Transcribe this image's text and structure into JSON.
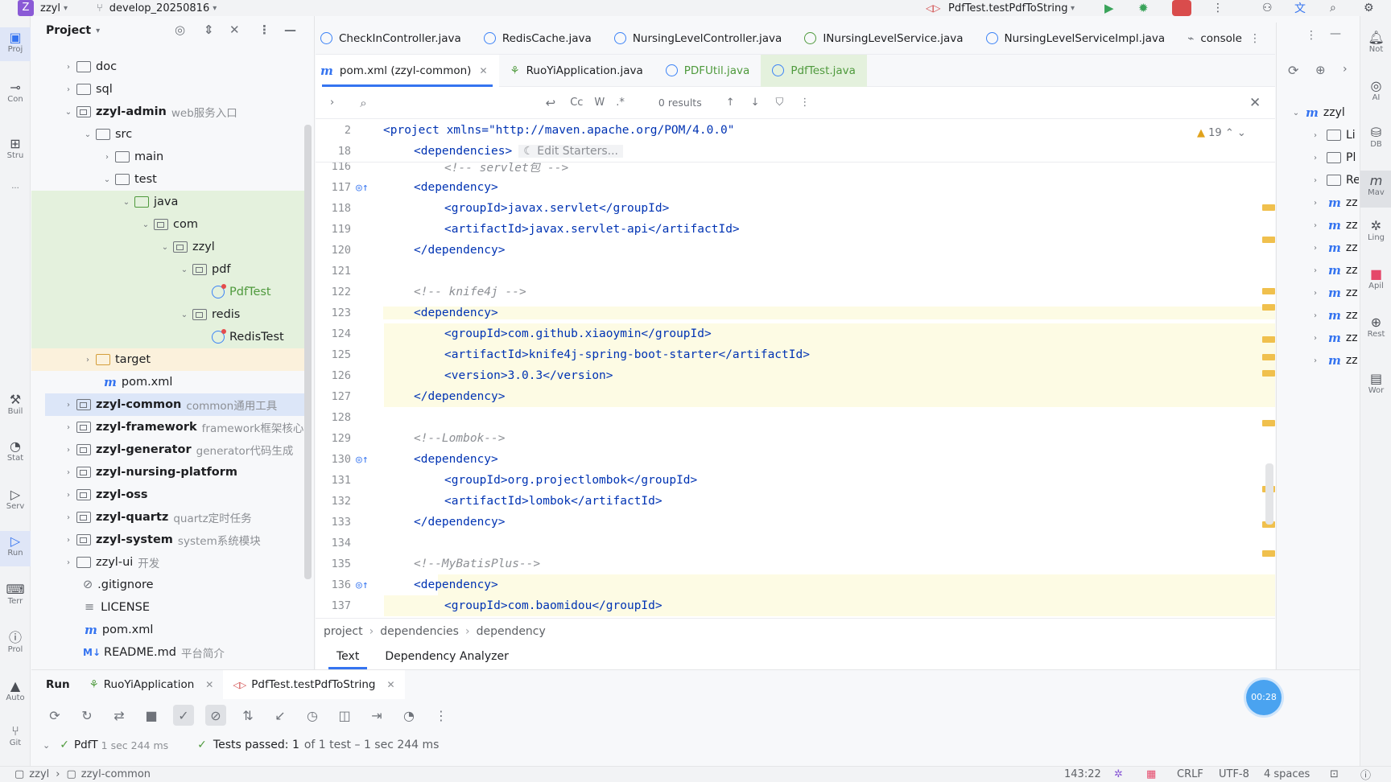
{
  "topbar": {
    "project_badge": "Z",
    "project_name": "zzyl",
    "branch": "develop_20250816",
    "run_config": "PdfTest.testPdfToString"
  },
  "left_strip": [
    "Proj",
    "Con",
    "Stru",
    "...",
    "Buil",
    "Stat",
    "Serv",
    "Run",
    "Terr",
    "Prol",
    "Auto",
    "Git"
  ],
  "project_panel": {
    "title": "Project",
    "tree": [
      {
        "label": "doc",
        "extra": ""
      },
      {
        "label": "sql",
        "extra": ""
      },
      {
        "label": "zzyl-admin",
        "extra": "web服务入口"
      },
      {
        "label": "src",
        "extra": ""
      },
      {
        "label": "main",
        "extra": ""
      },
      {
        "label": "test",
        "extra": ""
      },
      {
        "label": "java",
        "extra": ""
      },
      {
        "label": "com",
        "extra": ""
      },
      {
        "label": "zzyl",
        "extra": ""
      },
      {
        "label": "pdf",
        "extra": ""
      },
      {
        "label": "PdfTest",
        "extra": ""
      },
      {
        "label": "redis",
        "extra": ""
      },
      {
        "label": "RedisTest",
        "extra": ""
      },
      {
        "label": "target",
        "extra": ""
      },
      {
        "label": "pom.xml",
        "extra": ""
      },
      {
        "label": "zzyl-common",
        "extra": "common通用工具"
      },
      {
        "label": "zzyl-framework",
        "extra": "framework框架核心"
      },
      {
        "label": "zzyl-generator",
        "extra": "generator代码生成"
      },
      {
        "label": "zzyl-nursing-platform",
        "extra": ""
      },
      {
        "label": "zzyl-oss",
        "extra": ""
      },
      {
        "label": "zzyl-quartz",
        "extra": "quartz定时任务"
      },
      {
        "label": "zzyl-system",
        "extra": "system系统模块"
      },
      {
        "label": "zzyl-ui",
        "extra": "开发"
      },
      {
        "label": ".gitignore",
        "extra": ""
      },
      {
        "label": "LICENSE",
        "extra": ""
      },
      {
        "label": "pom.xml",
        "extra": ""
      },
      {
        "label": "README.md",
        "extra": "平台简介"
      }
    ]
  },
  "tabs_row1": [
    "CheckInController.java",
    "RedisCache.java",
    "NursingLevelController.java",
    "INursingLevelService.java",
    "NursingLevelServiceImpl.java",
    "console"
  ],
  "tabs_row2": [
    "pom.xml (zzyl-common)",
    "RuoYiApplication.java",
    "PDFUtil.java",
    "PdfTest.java"
  ],
  "search": {
    "results": "0 results",
    "case": "Cc",
    "word": "W",
    "regex": ".*"
  },
  "sticky": {
    "l1_num": "2",
    "l1_text": "<project xmlns=\"http://maven.apache.org/POM/4.0.0\"",
    "l2_num": "18",
    "l2_text": "<dependencies>",
    "l2_hint": "Edit Starters...",
    "warnings": "19"
  },
  "code_lines": [
    {
      "n": "116",
      "t": "<!-- servlet包 -->"
    },
    {
      "n": "117",
      "t": "<dependency>"
    },
    {
      "n": "118",
      "t": "<groupId>javax.servlet</groupId>"
    },
    {
      "n": "119",
      "t": "<artifactId>javax.servlet-api</artifactId>"
    },
    {
      "n": "120",
      "t": "</dependency>"
    },
    {
      "n": "121",
      "t": ""
    },
    {
      "n": "122",
      "t": "<!-- knife4j -->"
    },
    {
      "n": "123",
      "t": "<dependency>"
    },
    {
      "n": "124",
      "t": "<groupId>com.github.xiaoymin</groupId>"
    },
    {
      "n": "125",
      "t": "<artifactId>knife4j-spring-boot-starter</artifactId>"
    },
    {
      "n": "126",
      "t": "<version>3.0.3</version>"
    },
    {
      "n": "127",
      "t": "</dependency>"
    },
    {
      "n": "128",
      "t": ""
    },
    {
      "n": "129",
      "t": "<!--Lombok-->"
    },
    {
      "n": "130",
      "t": "<dependency>"
    },
    {
      "n": "131",
      "t": "<groupId>org.projectlombok</groupId>"
    },
    {
      "n": "132",
      "t": "<artifactId>lombok</artifactId>"
    },
    {
      "n": "133",
      "t": "</dependency>"
    },
    {
      "n": "134",
      "t": ""
    },
    {
      "n": "135",
      "t": "<!--MyBatisPlus-->"
    },
    {
      "n": "136",
      "t": "<dependency>"
    },
    {
      "n": "137",
      "t": "<groupId>com.baomidou</groupId>"
    }
  ],
  "breadcrumb": [
    "project",
    "dependencies",
    "dependency"
  ],
  "view_tabs": [
    "Text",
    "Dependency Analyzer"
  ],
  "maven": {
    "root": "zzyl",
    "items": [
      "Li",
      "Pl",
      "Re",
      "zz",
      "zz",
      "zz",
      "zz",
      "zz",
      "zz",
      "zz",
      "zz"
    ]
  },
  "right_strip": [
    "Not",
    "AI",
    "DB",
    "Mav",
    "Ling",
    "Apil",
    "Rest",
    "Wor"
  ],
  "run": {
    "title": "Run",
    "tab1": "RuoYiApplication",
    "tab2": "PdfTest.testPdfToString",
    "tree_item": "PdfT",
    "tree_time": "1 sec 244 ms",
    "result_bold": "Tests passed: 1",
    "result_rest": "of 1 test – 1 sec 244 ms",
    "timer": "00:28"
  },
  "status": {
    "path1": "zzyl",
    "path2": "zzyl-common",
    "pos": "143:22",
    "eol": "CRLF",
    "enc": "UTF-8",
    "indent": "4 spaces"
  }
}
